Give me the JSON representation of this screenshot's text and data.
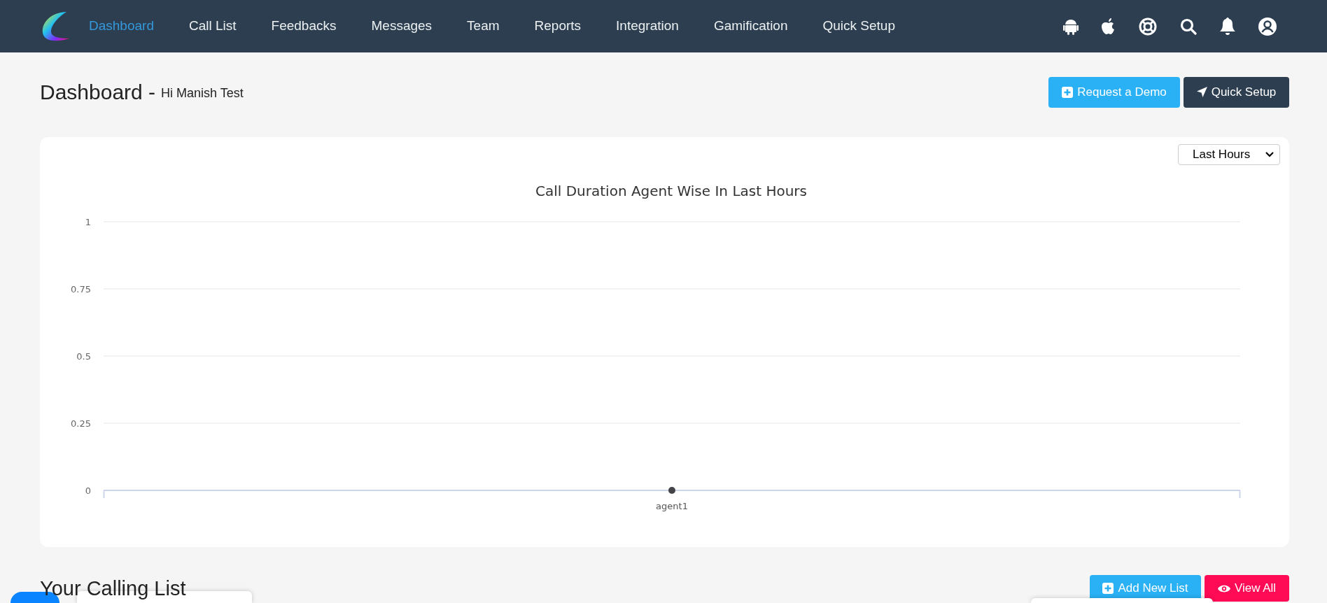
{
  "navbar": {
    "items": [
      {
        "label": "Dashboard",
        "selected": true
      },
      {
        "label": "Call List",
        "selected": false
      },
      {
        "label": "Feedbacks",
        "selected": false
      },
      {
        "label": "Messages",
        "selected": false
      },
      {
        "label": "Team",
        "selected": false
      },
      {
        "label": "Reports",
        "selected": false
      },
      {
        "label": "Integration",
        "selected": false
      },
      {
        "label": "Gamification",
        "selected": false
      },
      {
        "label": "Quick Setup",
        "selected": false
      }
    ]
  },
  "header": {
    "title": "Dashboard -",
    "greeting": "Hi Manish Test",
    "buttons": [
      {
        "kind": "demo",
        "label": "Request a Demo"
      },
      {
        "kind": "setup",
        "label": "Quick Setup"
      }
    ]
  },
  "chart_card": {
    "range_select": {
      "value": "Last Hours"
    },
    "chart_data": {
      "type": "line",
      "title": "Call Duration Agent Wise In Last Hours",
      "categories": [
        "agent1"
      ],
      "series": [
        {
          "color": "#434348",
          "marker": true,
          "values": [
            0
          ]
        }
      ],
      "grid": true,
      "ylim": [
        0,
        1
      ],
      "yticks": [
        0,
        0.25,
        0.5,
        0.75,
        1
      ]
    }
  },
  "calling_list": {
    "title": "Your Calling List",
    "buttons": [
      {
        "kind": "add",
        "label": "Add New List"
      },
      {
        "kind": "view",
        "label": "View All"
      }
    ]
  }
}
